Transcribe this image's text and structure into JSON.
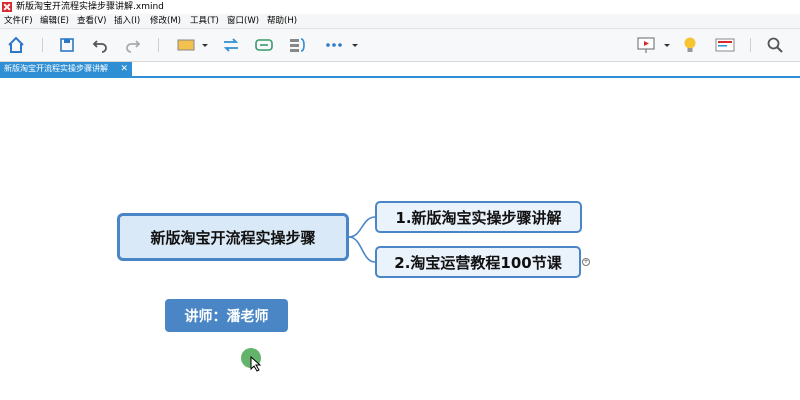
{
  "window": {
    "title": "新版淘宝开流程实操步骤讲解.xmind"
  },
  "menu": {
    "items": [
      "文件(F)",
      "编辑(E)",
      "查看(V)",
      "插入(I)",
      "修改(M)",
      "工具(T)",
      "窗口(W)",
      "帮助(H)"
    ]
  },
  "toolbar": {
    "icons": [
      "home-icon",
      "save-icon",
      "undo-icon",
      "redo-icon",
      "topic-style-icon",
      "relationship-icon",
      "boundary-icon",
      "summary-icon",
      "more-icon",
      "presentation-icon",
      "idea-icon",
      "outline-icon",
      "search-icon"
    ]
  },
  "tabs": [
    {
      "label": "新版淘宝开流程实操步骤讲解",
      "close": "✕"
    }
  ],
  "mindmap": {
    "root": "新版淘宝开流程实操步骤",
    "topics": [
      "1.新版淘宝实操步骤讲解",
      "2.淘宝运营教程100节课"
    ],
    "floating": "讲师：潘老师"
  },
  "colors": {
    "accent": "#4a86c5",
    "tab": "#2e8fd4",
    "root_fill": "#dae9f7",
    "teacher_fill": "#4a86c5"
  }
}
